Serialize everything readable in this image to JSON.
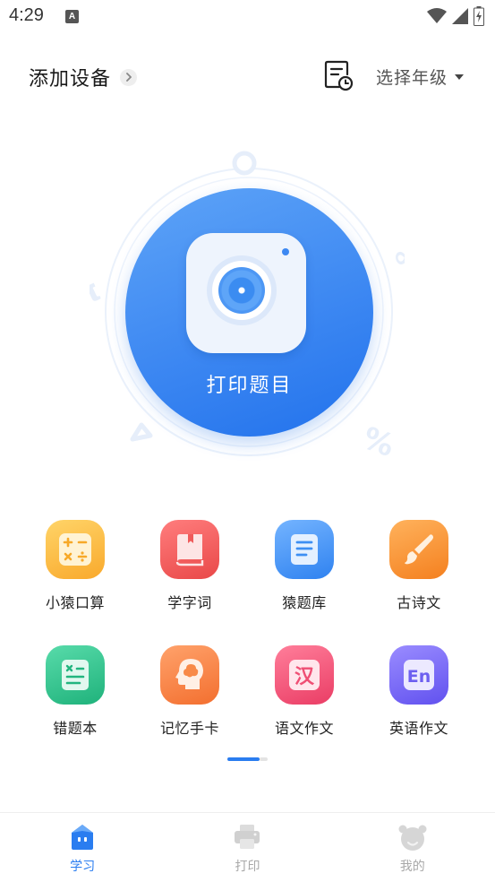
{
  "status_bar": {
    "time": "4:29",
    "notification_badge": "A"
  },
  "header": {
    "add_device_label": "添加设备",
    "grade_select_label": "选择年级"
  },
  "hero": {
    "print_label": "打印题目",
    "decor_symbols": {
      "percent": "%",
      "pi": "π",
      "infinity": "∞"
    }
  },
  "grid": {
    "items": [
      {
        "label": "小猿口算",
        "icon": "calculator-icon",
        "color": "#fbb53a"
      },
      {
        "label": "学字词",
        "icon": "book-icon",
        "color": "#ef5a5a"
      },
      {
        "label": "猿题库",
        "icon": "document-icon",
        "color": "#3d8ff3"
      },
      {
        "label": "古诗文",
        "icon": "brush-icon",
        "color": "#f89532"
      },
      {
        "label": "错题本",
        "icon": "notebook-icon",
        "color": "#2fc48f"
      },
      {
        "label": "记忆手卡",
        "icon": "brain-head-icon",
        "color": "#fa8a4a"
      },
      {
        "label": "语文作文",
        "icon": "han-char-icon",
        "icon_text": "汉",
        "color": "#f2587a"
      },
      {
        "label": "英语作文",
        "icon": "en-text-icon",
        "icon_text": "En",
        "color": "#7c6cf2"
      }
    ]
  },
  "pager": {
    "pages": 2,
    "current": 1
  },
  "bottom_nav": {
    "items": [
      {
        "label": "学习",
        "icon": "study-icon",
        "active": true
      },
      {
        "label": "打印",
        "icon": "printer-icon",
        "active": false
      },
      {
        "label": "我的",
        "icon": "profile-icon",
        "active": false
      }
    ],
    "active_color": "#2a7df0",
    "inactive_color": "#a8a8a8"
  }
}
